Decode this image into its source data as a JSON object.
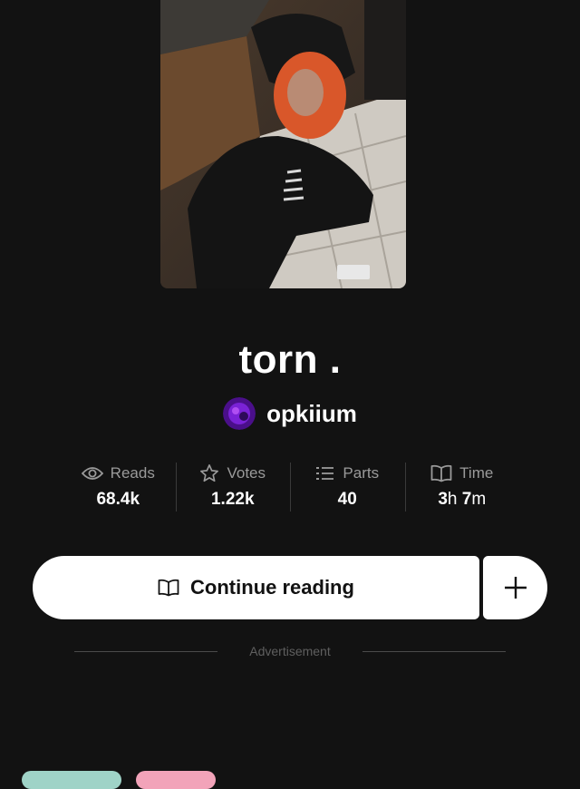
{
  "story": {
    "title": "torn .",
    "author": "opkiium"
  },
  "stats": [
    {
      "label": "Reads",
      "icon": "eye-icon",
      "value": "68.4k"
    },
    {
      "label": "Votes",
      "icon": "star-icon",
      "value": "1.22k"
    },
    {
      "label": "Parts",
      "icon": "list-icon",
      "value": "40"
    },
    {
      "label": "Time",
      "icon": "open-book-icon",
      "value_hours": "3",
      "unit_h": "h",
      "value_minutes": "7",
      "unit_m": "m"
    }
  ],
  "actions": {
    "continue_label": "Continue reading",
    "continue_icon": "open-book-icon",
    "add_icon": "plus-icon"
  },
  "advertisement": {
    "label": "Advertisement"
  },
  "colors": {
    "background": "#121212",
    "button_bg": "#ffffff",
    "muted_text": "#9a9a9a",
    "tag_teal": "#9fd3c7",
    "tag_pink": "#f2a3b9"
  }
}
